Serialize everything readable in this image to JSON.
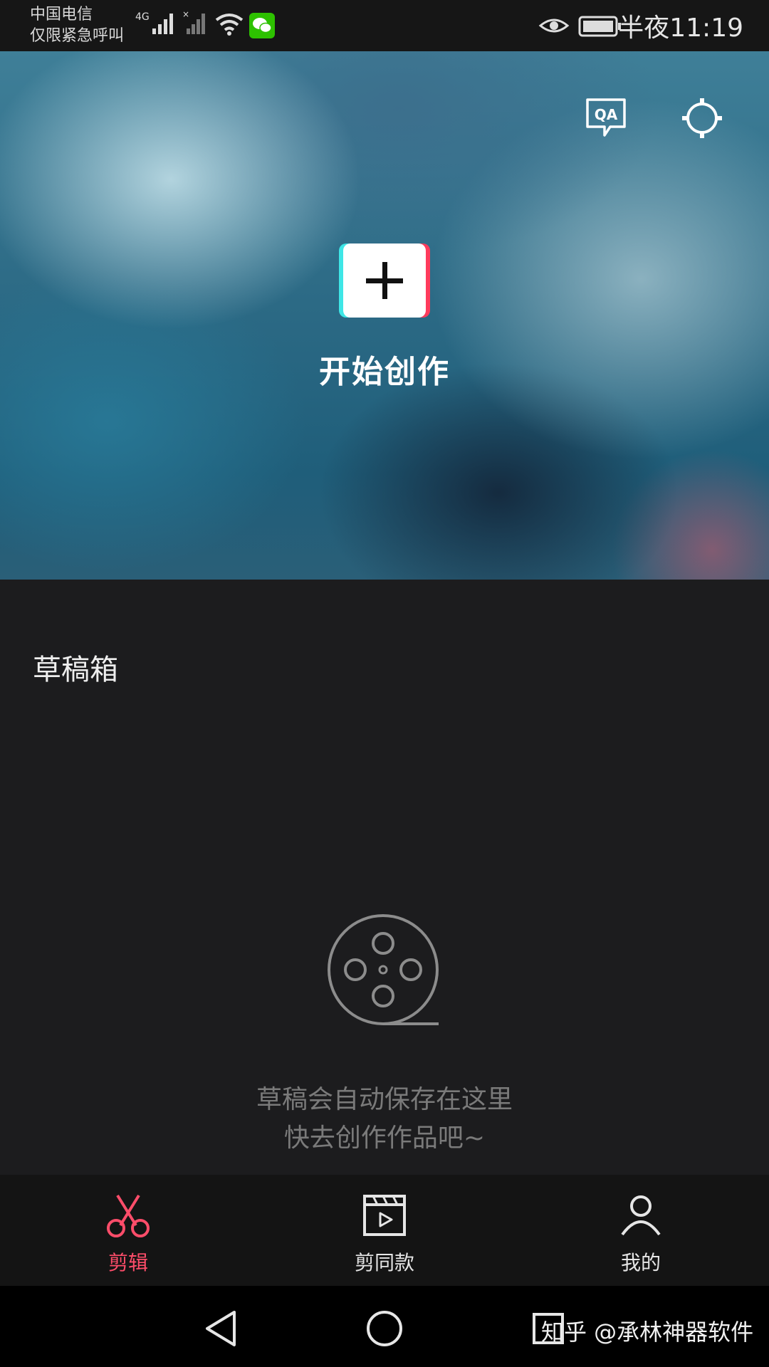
{
  "status_bar": {
    "carrier_line1": "中国电信",
    "carrier_line2": "仅限紧急呼叫",
    "network": "4G",
    "time": "半夜11:19",
    "icons": [
      "signal-icon",
      "signal-off-icon",
      "wifi-icon",
      "wechat-icon",
      "eye-icon",
      "battery-icon"
    ]
  },
  "hero": {
    "qa_label": "QA",
    "create_label": "开始创作"
  },
  "drafts": {
    "title": "草稿箱",
    "empty_line1": "草稿会自动保存在这里",
    "empty_line2": "快去创作作品吧~"
  },
  "tabs": [
    {
      "label": "剪辑",
      "icon": "scissors-icon",
      "active": true
    },
    {
      "label": "剪同款",
      "icon": "clapperboard-icon",
      "active": false
    },
    {
      "label": "我的",
      "icon": "profile-icon",
      "active": false
    }
  ],
  "watermark": "知乎 @承林神器软件",
  "colors": {
    "accent": "#ff4d6a",
    "background": "#1c1c1e",
    "tabbar": "#141414"
  }
}
